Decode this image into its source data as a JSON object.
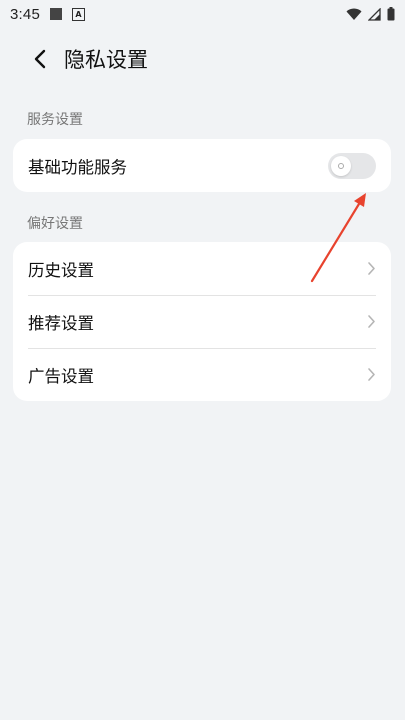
{
  "status_bar": {
    "time": "3:45"
  },
  "header": {
    "title": "隐私设置"
  },
  "sections": [
    {
      "label": "服务设置",
      "items": [
        {
          "label": "基础功能服务",
          "control": "toggle",
          "toggle_on": false
        }
      ]
    },
    {
      "label": "偏好设置",
      "items": [
        {
          "label": "历史设置",
          "control": "chevron"
        },
        {
          "label": "推荐设置",
          "control": "chevron"
        },
        {
          "label": "广告设置",
          "control": "chevron"
        }
      ]
    }
  ],
  "colors": {
    "background": "#f1f3f5",
    "card": "#ffffff",
    "annotation_arrow": "#e8432e",
    "toggle_off": "#e5e6e8"
  },
  "icons": {
    "back": "chevron-left-icon",
    "row_chevron": "chevron-right-icon",
    "wifi": "wifi-icon",
    "signal": "signal-icon",
    "battery": "battery-icon"
  }
}
